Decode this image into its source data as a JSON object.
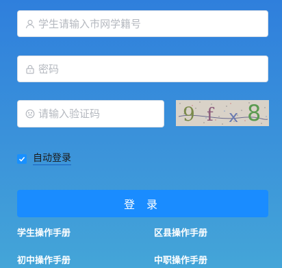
{
  "form": {
    "username_placeholder": "学生请输入市网学籍号",
    "password_placeholder": "密码",
    "captcha_placeholder": "请输入验证码",
    "captcha_image_text": "9fx8",
    "remember_label": "自动登录",
    "remember_checked": true,
    "login_label": "登 录"
  },
  "manuals": {
    "student": "学生操作手册",
    "district": "区县操作手册",
    "junior": "初中操作手册",
    "vocational": "中职操作手册"
  },
  "colors": {
    "background_top": "#2f7fdc",
    "background_bottom": "#44a5d8",
    "button": "#1a8cff",
    "checkbox": "#1890ff"
  },
  "icons": {
    "username": "user-icon",
    "password": "lock-icon",
    "captcha": "smile-icon",
    "remember": "check-icon"
  }
}
